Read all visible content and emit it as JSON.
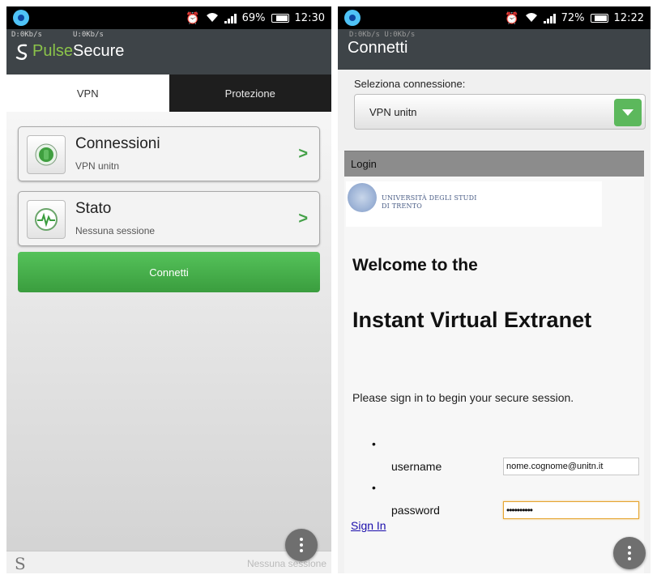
{
  "phone1": {
    "status": {
      "battery": "69%",
      "battery_level": 0.69,
      "time": "12:30"
    },
    "speed": {
      "down": "D:0Kb/s",
      "up": "U:0Kb/s"
    },
    "brand": {
      "part1": "Pulse",
      "part2": "Secure"
    },
    "tabs": [
      {
        "label": "VPN",
        "active": true
      },
      {
        "label": "Protezione",
        "active": false
      }
    ],
    "cards": [
      {
        "title": "Connessioni",
        "subtitle": "VPN unitn",
        "icon": "connection-icon"
      },
      {
        "title": "Stato",
        "subtitle": "Nessuna sessione",
        "icon": "heartbeat-icon"
      }
    ],
    "connect_label": "Connetti",
    "bottom": {
      "logo_glyph": "S",
      "status": "Nessuna sessione"
    }
  },
  "phone2": {
    "status": {
      "battery": "72%",
      "battery_level": 0.72,
      "time": "12:22"
    },
    "header_ghost": "D:0Kb/s  U:0Kb/s",
    "header_title": "Connetti",
    "select_label": "Seleziona connessione:",
    "select_value": "VPN unitn",
    "login_title": "Login",
    "logo": {
      "line1": "UNIVERSITÀ DEGLI STUDI",
      "line2": "DI TRENTO"
    },
    "welcome": "Welcome to the",
    "heading": "Instant Virtual Extranet",
    "instructions": "Please sign in to begin your secure session.",
    "bullet": "•",
    "fields": {
      "username_label": "username",
      "username_value": "nome.cognome@unitn.it",
      "password_label": "password",
      "password_value": "••••••••••"
    },
    "signin_label": "Sign In"
  },
  "colors": {
    "accent_green": "#3a9d3e",
    "header": "#3e4448",
    "link": "#1a0dab",
    "focus_border": "#e6a531"
  }
}
